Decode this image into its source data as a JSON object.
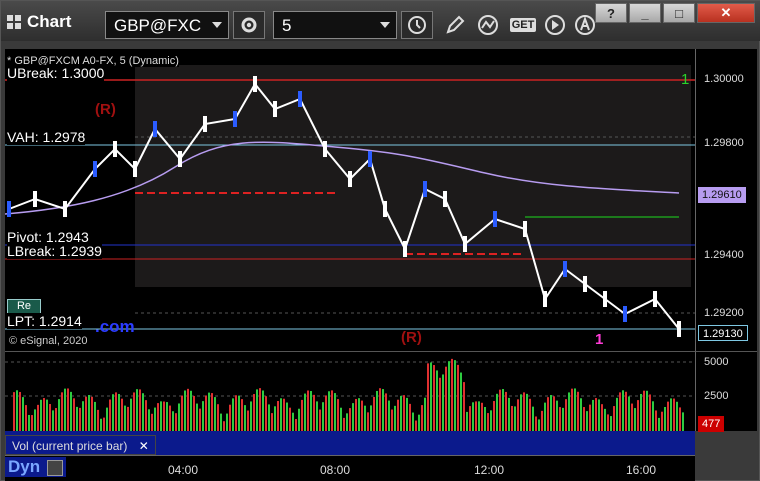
{
  "app": {
    "title": "Chart"
  },
  "toolbar": {
    "symbol": "GBP@FXC",
    "interval": "5",
    "help": "?",
    "minimize": "_",
    "maximize": "□",
    "close": "✕",
    "get_label": "GET"
  },
  "chart": {
    "instrument": "* GBP@FXCM A0-FX, 5 (Dynamic)",
    "copyright": "© eSignal, 2020",
    "watermark": ".com",
    "levels": {
      "ubreak": "UBreak: 1.3000",
      "vah": "VAH: 1.2978",
      "pivot": "Pivot: 1.2943",
      "lbreak": "LBreak: 1.2939",
      "lpt": "LPT: 1.2914"
    },
    "markers": {
      "r1": "(R)",
      "r2": "(R)",
      "pink1": "1",
      "green1": "1"
    },
    "y_ticks": [
      "1.30000",
      "1.29800",
      "1.29400",
      "1.29200"
    ],
    "price_tags": {
      "current": "1.29610",
      "last": "1.29130"
    },
    "x_ticks": [
      "04:00",
      "08:00",
      "12:00",
      "16:00"
    ],
    "mini_btn": "Re"
  },
  "volume": {
    "label": "Vol (current price bar)",
    "y_ticks": [
      "5000",
      "2500"
    ],
    "current": "477"
  },
  "status": {
    "dyn": "Dyn"
  },
  "colors": {
    "window": "#3a3a3a",
    "accent_blue": "#0b1a8c",
    "candle_white": "#ffffff",
    "candle_blue": "#2b5cff",
    "vol_red": "#cc0000"
  }
}
